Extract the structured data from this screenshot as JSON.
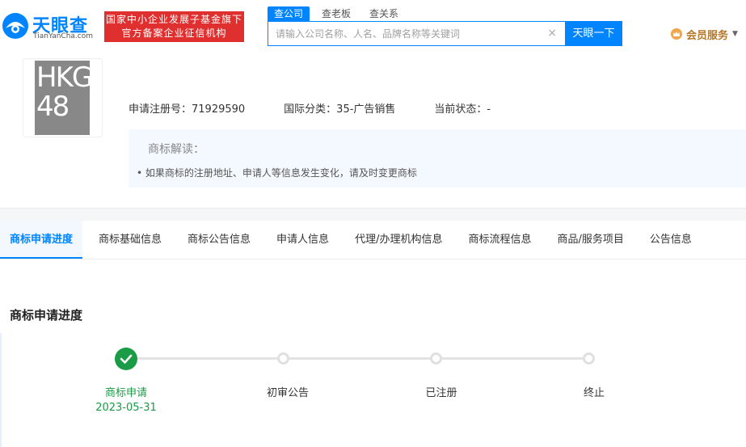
{
  "header": {
    "logo_cn": "天眼查",
    "logo_en": "TianYanCha.com",
    "gov_badge_line1": "国家中小企业发展子基金旗下",
    "gov_badge_line2": "官方备案企业征信机构",
    "search_tabs": [
      "查公司",
      "查老板",
      "查关系"
    ],
    "search_placeholder": "请输入公司名称、人名、品牌名称等关键词",
    "clear_label": "×",
    "search_button": "天眼一下",
    "member_label": "会员服务"
  },
  "trademark": {
    "image_text_line1": "HKG",
    "image_text_line2": "48",
    "reg_no": "申请注册号：71929590",
    "intl_class": "国际分类：35-广告销售",
    "status": "当前状态：-",
    "tip_title": "商标解读：",
    "tip_item": "•  如果商标的注册地址、申请人等信息发生变化，请及时变更商标"
  },
  "tabs": [
    {
      "label": "商标申请进度",
      "active": true
    },
    {
      "label": "商标基础信息",
      "active": false
    },
    {
      "label": "商标公告信息",
      "active": false
    },
    {
      "label": "申请人信息",
      "active": false
    },
    {
      "label": "代理/办理机构信息",
      "active": false
    },
    {
      "label": "商标流程信息",
      "active": false
    },
    {
      "label": "商品/服务项目",
      "active": false
    },
    {
      "label": "公告信息",
      "active": false
    }
  ],
  "progress": {
    "title": "商标申请进度",
    "steps": [
      {
        "label": "商标申请",
        "date": "2023-05-31",
        "done": true
      },
      {
        "label": "初审公告",
        "date": "",
        "done": false
      },
      {
        "label": "已注册",
        "date": "",
        "done": false
      },
      {
        "label": "终止",
        "date": "",
        "done": false
      }
    ]
  },
  "colors": {
    "brand_blue": "#0084ff",
    "badge_red": "#e02f2f",
    "done_green": "#1a9b45",
    "member_gold": "#b5762a"
  }
}
